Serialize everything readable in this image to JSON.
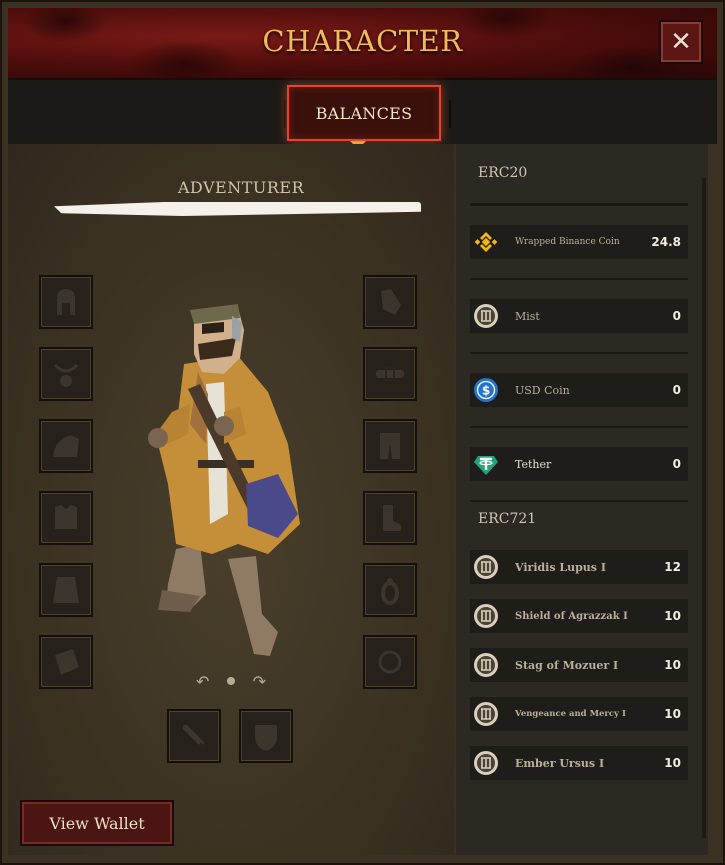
{
  "header": {
    "title": "CHARACTER",
    "close_label": "✕"
  },
  "tabs": [
    {
      "label": "BALANCES",
      "active": true
    }
  ],
  "character": {
    "heading": "ADVENTURER",
    "rotate_left": "↶",
    "rotate_right": "↷"
  },
  "equipment_slots": {
    "left": [
      "helmet-slot",
      "amulet-slot",
      "shoulder-slot",
      "chest-slot",
      "cape-slot",
      "bracer-slot"
    ],
    "right": [
      "gloves-slot",
      "belt-slot",
      "pants-slot",
      "boots-slot",
      "ring-slot",
      "trinket-slot"
    ],
    "bottom": [
      "weapon-slot",
      "shield-slot"
    ]
  },
  "view_wallet_label": "View Wallet",
  "erc20": {
    "title": "ERC20",
    "items": [
      {
        "name": "Wrapped Binance Coin",
        "value": "24.8",
        "icon": "bnb-icon",
        "color": "#f0b90b"
      },
      {
        "name": "Mist",
        "value": "0",
        "icon": "mist-icon",
        "color": "#d8cfbf"
      },
      {
        "name": "USD Coin",
        "value": "0",
        "icon": "usdc-icon",
        "color": "#2775ca"
      },
      {
        "name": "Tether",
        "value": "0",
        "icon": "tether-icon",
        "color": "#26a17b"
      }
    ]
  },
  "erc721": {
    "title": "ERC721",
    "items": [
      {
        "name": "Viridis Lupus I",
        "value": "12"
      },
      {
        "name": "Shield of Agrazzak I",
        "value": "10"
      },
      {
        "name": "Stag of Mozuer I",
        "value": "10"
      },
      {
        "name": "Vengeance and Mercy I",
        "value": "10"
      },
      {
        "name": "Ember Ursus I",
        "value": "10"
      }
    ]
  },
  "colors": {
    "accent": "#e2452b",
    "title_gold": "#f2b95a",
    "panel_dark": "#2c2923"
  }
}
